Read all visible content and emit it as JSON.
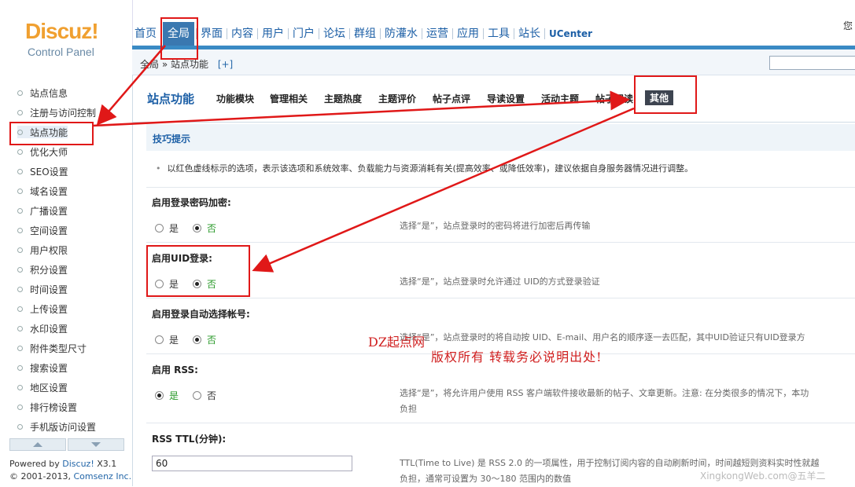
{
  "header": {
    "logo": "Discuz!",
    "logo_sub": "Control Panel",
    "top_right": "您",
    "nav": [
      {
        "label": "首页",
        "active": false
      },
      {
        "label": "全局",
        "active": true
      },
      {
        "label": "界面",
        "active": false
      },
      {
        "label": "内容",
        "active": false
      },
      {
        "label": "用户",
        "active": false
      },
      {
        "label": "门户",
        "active": false
      },
      {
        "label": "论坛",
        "active": false
      },
      {
        "label": "群组",
        "active": false
      },
      {
        "label": "防灌水",
        "active": false
      },
      {
        "label": "运营",
        "active": false
      },
      {
        "label": "应用",
        "active": false
      },
      {
        "label": "工具",
        "active": false
      },
      {
        "label": "站长",
        "active": false
      },
      {
        "label": "UCenter",
        "active": false
      }
    ],
    "breadcrumb": "全局 » 站点功能",
    "breadcrumb_plus": "[+]"
  },
  "sidebar": {
    "items": [
      {
        "label": "站点信息"
      },
      {
        "label": "注册与访问控制"
      },
      {
        "label": "站点功能"
      },
      {
        "label": "优化大师"
      },
      {
        "label": "SEO设置"
      },
      {
        "label": "域名设置"
      },
      {
        "label": "广播设置"
      },
      {
        "label": "空间设置"
      },
      {
        "label": "用户权限"
      },
      {
        "label": "积分设置"
      },
      {
        "label": "时间设置"
      },
      {
        "label": "上传设置"
      },
      {
        "label": "水印设置"
      },
      {
        "label": "附件类型尺寸"
      },
      {
        "label": "搜索设置"
      },
      {
        "label": "地区设置"
      },
      {
        "label": "排行榜设置"
      },
      {
        "label": "手机版访问设置"
      }
    ],
    "active_index": 2,
    "powered_prefix": "Powered by ",
    "powered_link": "Discuz!",
    "powered_version": " X3.1",
    "copyright_prefix": "© 2001-2013, ",
    "copyright_link": "Comsenz Inc."
  },
  "content": {
    "section_title": "站点功能",
    "tabs": [
      "功能模块",
      "管理相关",
      "主题热度",
      "主题评价",
      "帖子点评",
      "导读设置",
      "活动主题",
      "帖子阅读",
      "其他"
    ],
    "tips_title": "技巧提示",
    "tips_text": "以红色虚线标示的选项，表示该选项和系统效率、负载能力与资源消耗有关(提高效率、或降低效率)，建议依据自身服务器情况进行调整。",
    "settings": [
      {
        "title": "启用登录密码加密:",
        "yes": "是",
        "no": "否",
        "selected": "no",
        "desc": "选择“是”，站点登录时的密码将进行加密后再传输"
      },
      {
        "title": "启用UID登录:",
        "yes": "是",
        "no": "否",
        "selected": "no",
        "desc": "选择“是”，站点登录时允许通过 UID的方式登录验证"
      },
      {
        "title": "启用登录自动选择帐号:",
        "yes": "是",
        "no": "否",
        "selected": "no",
        "desc": "选择“是”，站点登录时的将自动按 UID、E-mail、用户名的顺序逐一去匹配，其中UID验证只有UID登录方"
      },
      {
        "title": "启用 RSS:",
        "yes": "是",
        "no": "否",
        "selected": "yes",
        "desc": "选择“是”，将允许用户使用 RSS 客户端软件接收最新的帖子、文章更新。注意: 在分类很多的情况下，本功",
        "desc2": "负担"
      }
    ],
    "rss_ttl_title": "RSS TTL(分钟):",
    "rss_ttl_value": "60",
    "rss_ttl_desc": "TTL(Time to Live) 是 RSS 2.0 的一项属性，用于控制订阅内容的自动刷新时间，时间越短则资料实时性就越",
    "rss_ttl_desc2": "负担，通常可设置为 30～180 范围内的数值"
  },
  "annotations": {
    "watermark1": "DZ起点网",
    "watermark2": "版权所有   转载务必说明出处!",
    "watermark3": "XingkongWeb.com@五羊二",
    "color": "#e01818"
  }
}
